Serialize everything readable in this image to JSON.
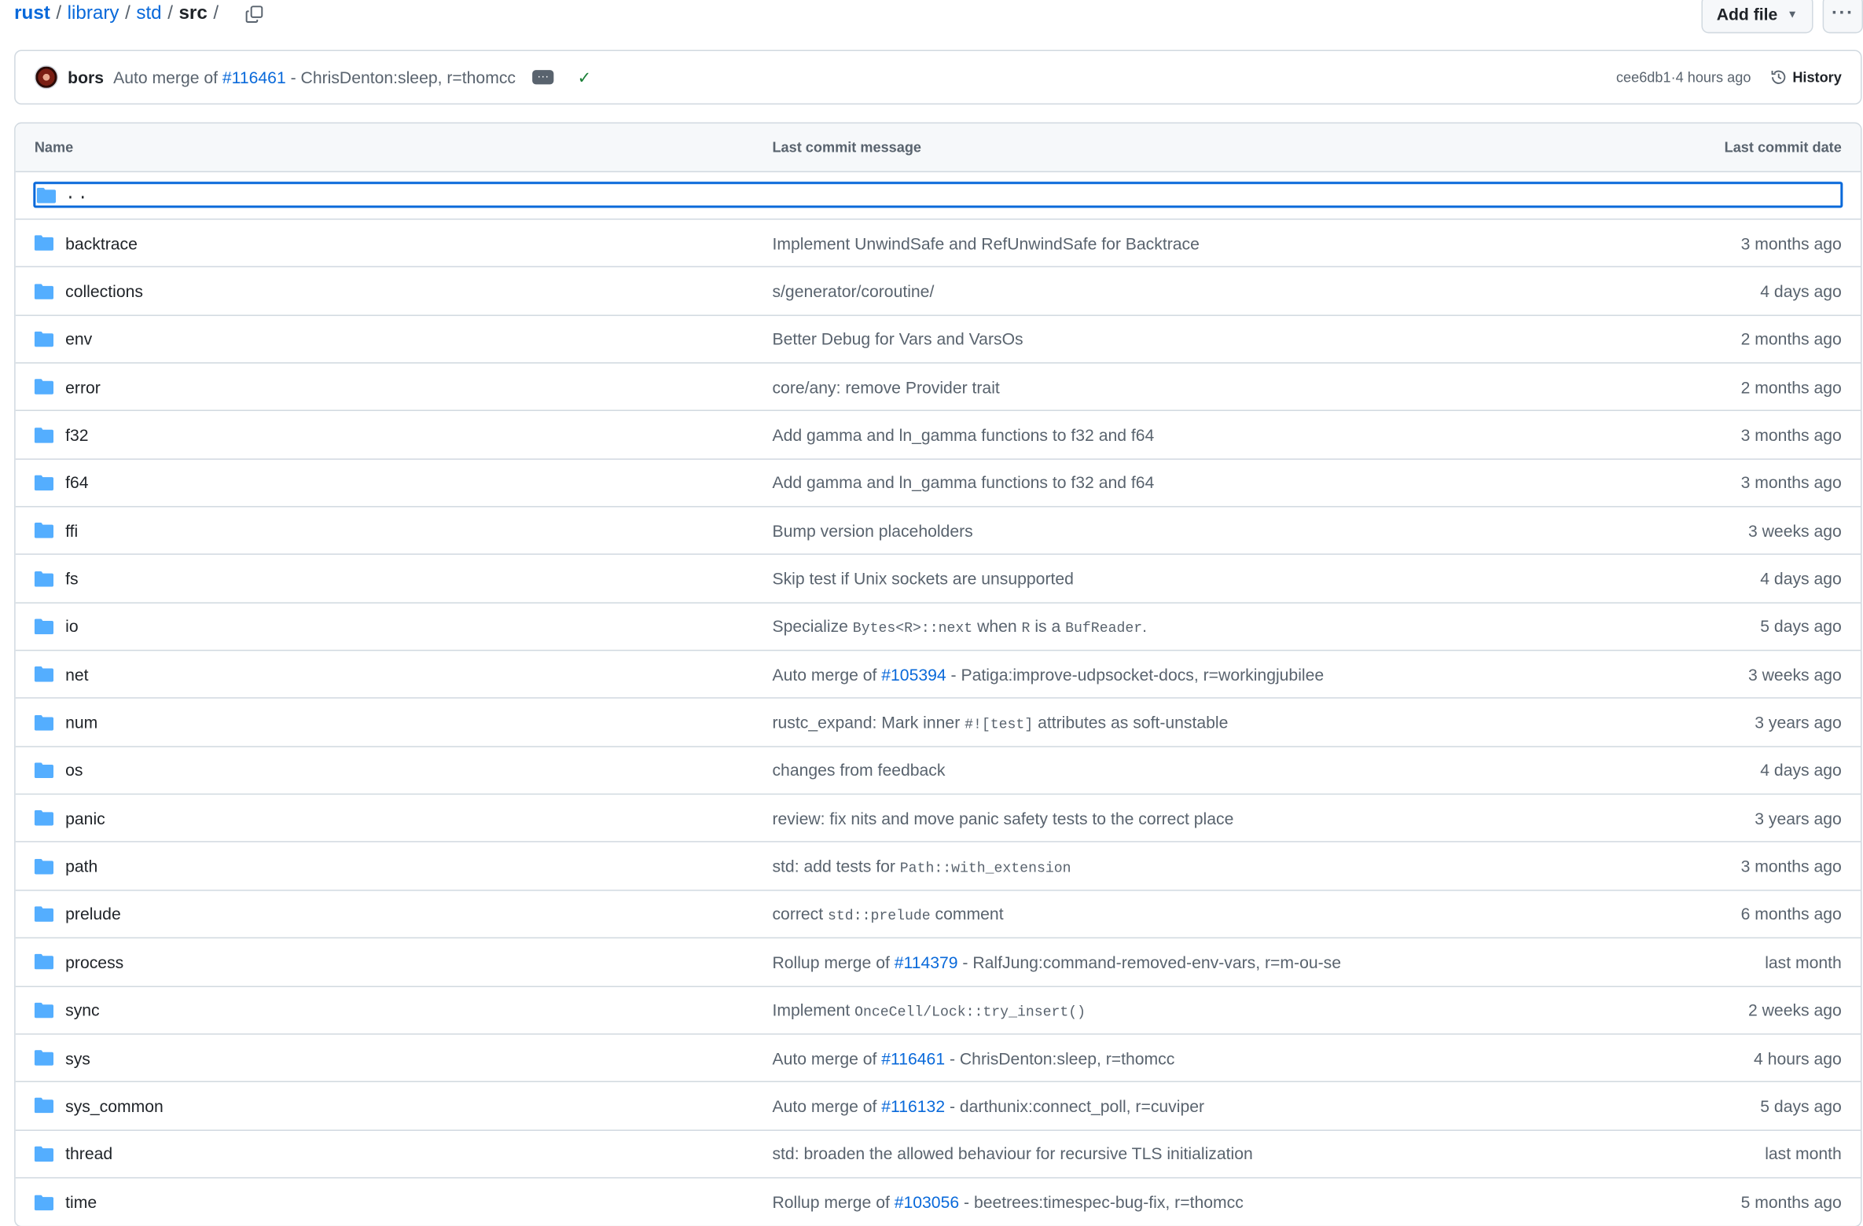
{
  "breadcrumb": {
    "repo": "rust",
    "segments": [
      "library",
      "std"
    ],
    "current": "src",
    "sep": "/"
  },
  "actions": {
    "add_file": "Add file",
    "more": "···"
  },
  "commit": {
    "author": "bors",
    "message_prefix": "Auto merge of",
    "pr": "#116461",
    "message_suffix": "- ChrisDenton:sleep, r=thomcc",
    "ellipsis": "···",
    "check": "✓",
    "sha": "cee6db1",
    "separator": " · ",
    "time": "4 hours ago",
    "history_label": "History"
  },
  "table": {
    "headers": {
      "name": "Name",
      "message": "Last commit message",
      "date": "Last commit date"
    },
    "parent": "..",
    "rows": [
      {
        "name": "backtrace",
        "msg": [
          {
            "t": "Implement UnwindSafe and RefUnwindSafe for Backtrace"
          }
        ],
        "date": "3 months ago"
      },
      {
        "name": "collections",
        "msg": [
          {
            "t": "s/generator/coroutine/"
          }
        ],
        "date": "4 days ago"
      },
      {
        "name": "env",
        "msg": [
          {
            "t": "Better Debug for Vars and VarsOs"
          }
        ],
        "date": "2 months ago"
      },
      {
        "name": "error",
        "msg": [
          {
            "t": "core/any: remove Provider trait"
          }
        ],
        "date": "2 months ago"
      },
      {
        "name": "f32",
        "msg": [
          {
            "t": "Add gamma and ln_gamma functions to f32 and f64"
          }
        ],
        "date": "3 months ago"
      },
      {
        "name": "f64",
        "msg": [
          {
            "t": "Add gamma and ln_gamma functions to f32 and f64"
          }
        ],
        "date": "3 months ago"
      },
      {
        "name": "ffi",
        "msg": [
          {
            "t": "Bump version placeholders"
          }
        ],
        "date": "3 weeks ago"
      },
      {
        "name": "fs",
        "msg": [
          {
            "t": "Skip test if Unix sockets are unsupported"
          }
        ],
        "date": "4 days ago"
      },
      {
        "name": "io",
        "msg": [
          {
            "t": "Specialize "
          },
          {
            "c": "Bytes<R>::next"
          },
          {
            "t": " when "
          },
          {
            "c": "R"
          },
          {
            "t": " is a "
          },
          {
            "c": "BufReader"
          },
          {
            "t": "."
          }
        ],
        "date": "5 days ago"
      },
      {
        "name": "net",
        "msg": [
          {
            "t": "Auto merge of "
          },
          {
            "p": "#105394"
          },
          {
            "t": " - Patiga:improve-udpsocket-docs, r=workingjubilee"
          }
        ],
        "date": "3 weeks ago"
      },
      {
        "name": "num",
        "msg": [
          {
            "t": "rustc_expand: Mark inner "
          },
          {
            "c": "#![test]"
          },
          {
            "t": " attributes as soft-unstable"
          }
        ],
        "date": "3 years ago"
      },
      {
        "name": "os",
        "msg": [
          {
            "t": "changes from feedback"
          }
        ],
        "date": "4 days ago"
      },
      {
        "name": "panic",
        "msg": [
          {
            "t": "review: fix nits and move panic safety tests to the correct place"
          }
        ],
        "date": "3 years ago"
      },
      {
        "name": "path",
        "msg": [
          {
            "t": "std: add tests for "
          },
          {
            "c": "Path::with_extension"
          }
        ],
        "date": "3 months ago"
      },
      {
        "name": "prelude",
        "msg": [
          {
            "t": "correct "
          },
          {
            "c": "std::prelude"
          },
          {
            "t": " comment"
          }
        ],
        "date": "6 months ago"
      },
      {
        "name": "process",
        "msg": [
          {
            "t": "Rollup merge of "
          },
          {
            "p": "#114379"
          },
          {
            "t": " - RalfJung:command-removed-env-vars, r=m-ou-se"
          }
        ],
        "date": "last month"
      },
      {
        "name": "sync",
        "msg": [
          {
            "t": "Implement "
          },
          {
            "c": "OnceCell/Lock::try_insert()"
          }
        ],
        "date": "2 weeks ago"
      },
      {
        "name": "sys",
        "msg": [
          {
            "t": "Auto merge of "
          },
          {
            "p": "#116461"
          },
          {
            "t": " - ChrisDenton:sleep, r=thomcc"
          }
        ],
        "date": "4 hours ago"
      },
      {
        "name": "sys_common",
        "msg": [
          {
            "t": "Auto merge of "
          },
          {
            "p": "#116132"
          },
          {
            "t": " - darthunix:connect_poll, r=cuviper"
          }
        ],
        "date": "5 days ago"
      },
      {
        "name": "thread",
        "msg": [
          {
            "t": "std: broaden the allowed behaviour for recursive TLS initialization"
          }
        ],
        "date": "last month"
      },
      {
        "name": "time",
        "msg": [
          {
            "t": "Rollup merge of "
          },
          {
            "p": "#103056"
          },
          {
            "t": " - beetrees:timespec-bug-fix, r=thomcc"
          }
        ],
        "date": "5 months ago"
      }
    ]
  },
  "colors": {
    "link": "#0969da",
    "folder": "#54aeff",
    "muted": "#59636e",
    "success": "#1a7f37",
    "border": "#d1d9e0"
  },
  "icons": {
    "folder": "folder-icon",
    "copy": "copy-icon",
    "history": "history-icon",
    "check": "check-icon",
    "caret": "triangle-down-icon"
  }
}
